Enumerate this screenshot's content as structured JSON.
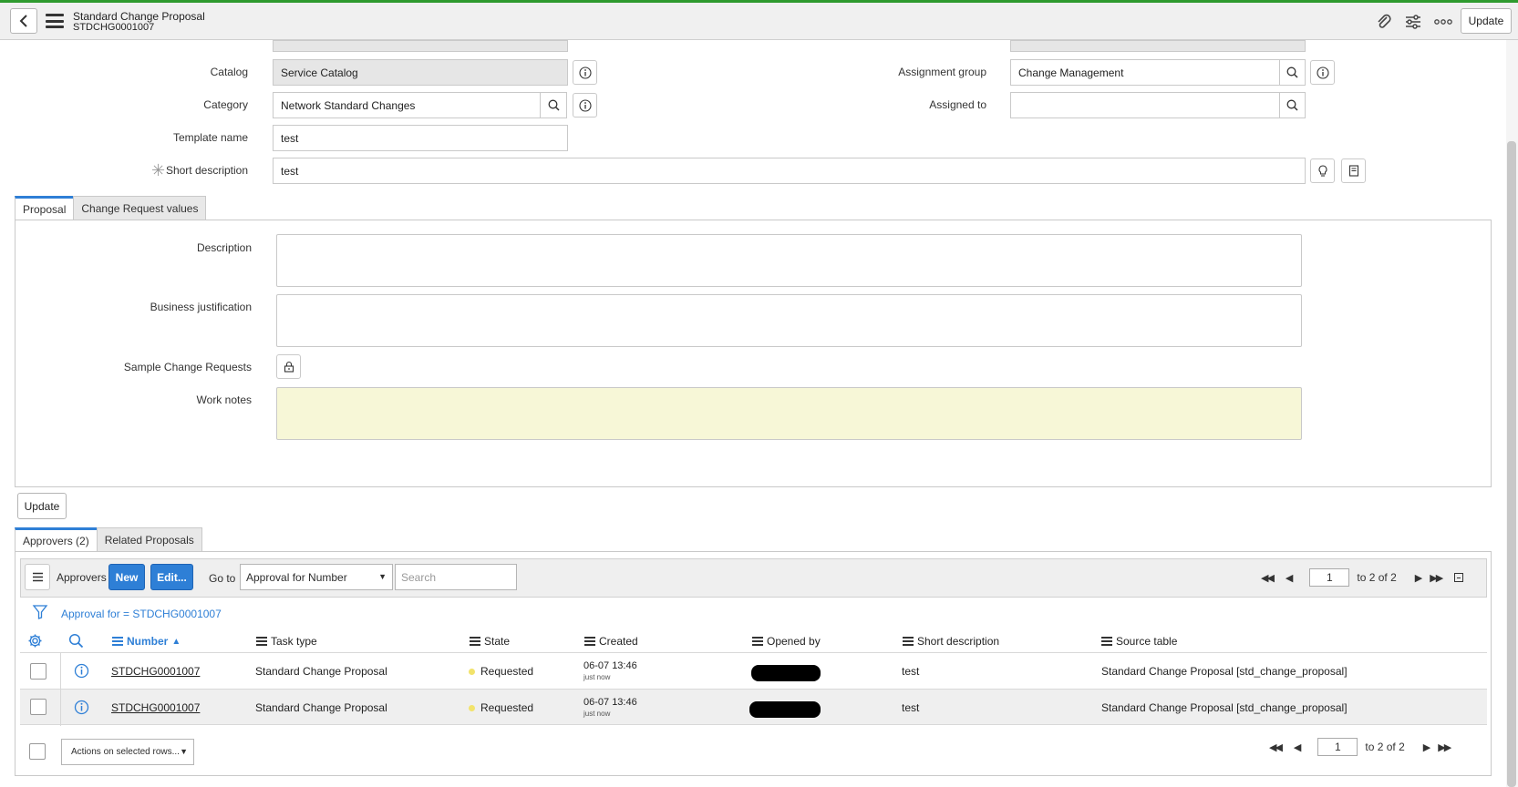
{
  "header": {
    "title": "Standard Change Proposal",
    "number": "STDCHG0001007",
    "update_label": "Update"
  },
  "form": {
    "catalog_label": "Catalog",
    "catalog_value": "Service Catalog",
    "category_label": "Category",
    "category_value": "Network Standard Changes",
    "template_name_label": "Template name",
    "template_name_value": "test",
    "short_description_label": "Short description",
    "short_description_value": "test",
    "assignment_group_label": "Assignment group",
    "assignment_group_value": "Change Management",
    "assigned_to_label": "Assigned to",
    "assigned_to_value": ""
  },
  "form_tabs": [
    {
      "label": "Proposal",
      "active": true
    },
    {
      "label": "Change Request values",
      "active": false
    }
  ],
  "proposal": {
    "description_label": "Description",
    "business_justification_label": "Business justification",
    "sample_change_requests_label": "Sample Change Requests",
    "work_notes_label": "Work notes"
  },
  "update_button": "Update",
  "related_tabs": [
    {
      "label": "Approvers (2)",
      "active": true
    },
    {
      "label": "Related Proposals",
      "active": false
    }
  ],
  "list": {
    "title": "Approvers",
    "new_label": "New",
    "edit_label": "Edit...",
    "goto_label": "Go to",
    "goto_select": "Approval for Number",
    "search_placeholder": "Search",
    "page_value": "1",
    "page_total": "to 2 of 2",
    "filter_text": "Approval for = STDCHG0001007",
    "columns": [
      "Number",
      "Task type",
      "State",
      "Created",
      "Opened by",
      "Short description",
      "Source table"
    ],
    "rows": [
      {
        "number": "STDCHG0001007",
        "task_type": "Standard Change Proposal",
        "state": "Requested",
        "created": "06-07 13:46",
        "created_rel": "just now",
        "short_description": "test",
        "source_table": "Standard Change Proposal [std_change_proposal]"
      },
      {
        "number": "STDCHG0001007",
        "task_type": "Standard Change Proposal",
        "state": "Requested",
        "created": "06-07 13:46",
        "created_rel": "just now",
        "short_description": "test",
        "source_table": "Standard Change Proposal [std_change_proposal]"
      }
    ],
    "actions_select": "Actions on selected rows..."
  },
  "colors": {
    "accent": "#2e7fd6",
    "top_border": "#2e9a2e",
    "work_notes_bg": "#f7f7d7",
    "state_requested": "#f2e36b"
  }
}
